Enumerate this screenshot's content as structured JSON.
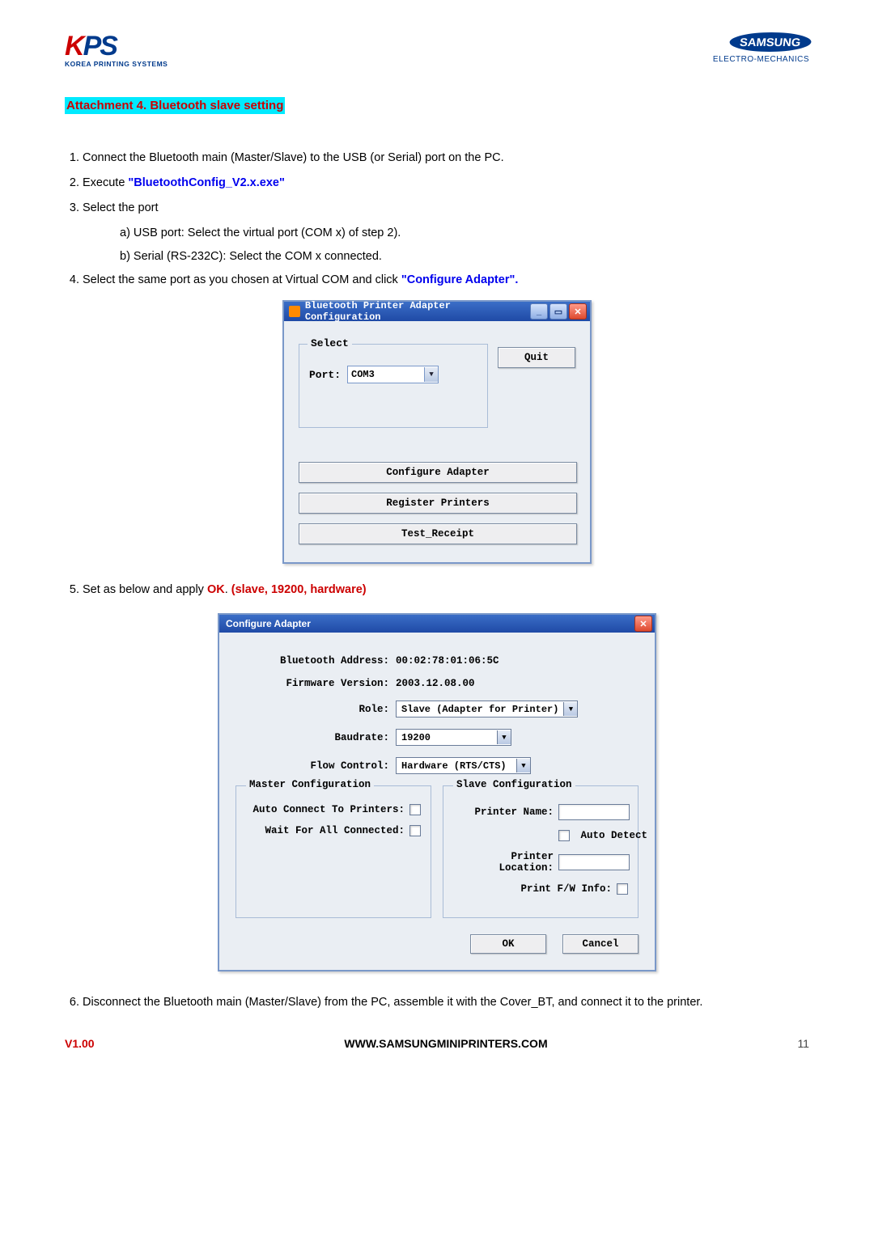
{
  "logos": {
    "kps_sub": "KOREA PRINTING SYSTEMS",
    "samsung_main": "SAMSUNG",
    "samsung_sub": "ELECTRO-MECHANICS"
  },
  "section_title": "Attachment 4. Bluetooth slave setting",
  "steps": {
    "s1": "Connect the Bluetooth main (Master/Slave) to the USB (or Serial) port on the PC.",
    "s2_a": "Execute ",
    "s2_link": "\"BluetoothConfig_V2.x.exe\"",
    "s3": "Select the port",
    "s3a": "a) USB port: Select the virtual port (COM x) of step 2).",
    "s3b": "b) Serial (RS-232C): Select the COM x connected.",
    "s4_a": "Select the same port as you chosen at Virtual COM and click ",
    "s4_link": "\"Configure Adapter\".",
    "s5_a": "Set as below and apply ",
    "s5_b": "OK",
    "s5_c": ". ",
    "s5_d": "(slave, 19200, hardware)",
    "s6": "Disconnect the Bluetooth main (Master/Slave) from the PC, assemble it with the Cover_BT, and connect it to the printer."
  },
  "win1": {
    "title": "Bluetooth Printer Adapter Configuration",
    "select_legend": "Select",
    "port_label": "Port:",
    "port_value": "COM3",
    "quit": "Quit",
    "btn_configure": "Configure Adapter",
    "btn_register": "Register Printers",
    "btn_test": "Test_Receipt"
  },
  "win2": {
    "title": "Configure Adapter",
    "bt_addr_label": "Bluetooth Address:",
    "bt_addr_value": "00:02:78:01:06:5C",
    "fw_label": "Firmware Version:",
    "fw_value": "2003.12.08.00",
    "role_label": "Role:",
    "role_value": "Slave  (Adapter for Printer)",
    "baud_label": "Baudrate:",
    "baud_value": "19200",
    "flow_label": "Flow Control:",
    "flow_value": "Hardware (RTS/CTS)",
    "master_legend": "Master Configuration",
    "m_auto_label": "Auto Connect To Printers:",
    "m_wait_label": "Wait For All Connected:",
    "slave_legend": "Slave Configuration",
    "s_name_label": "Printer Name:",
    "s_autodetect_label": "Auto Detect",
    "s_loc_label": "Printer Location:",
    "s_fw_label": "Print F/W Info:",
    "ok": "OK",
    "cancel": "Cancel"
  },
  "footer": {
    "version": "V1.00",
    "url": "WWW.SAMSUNGMINIPRINTERS.COM",
    "page": "11"
  }
}
